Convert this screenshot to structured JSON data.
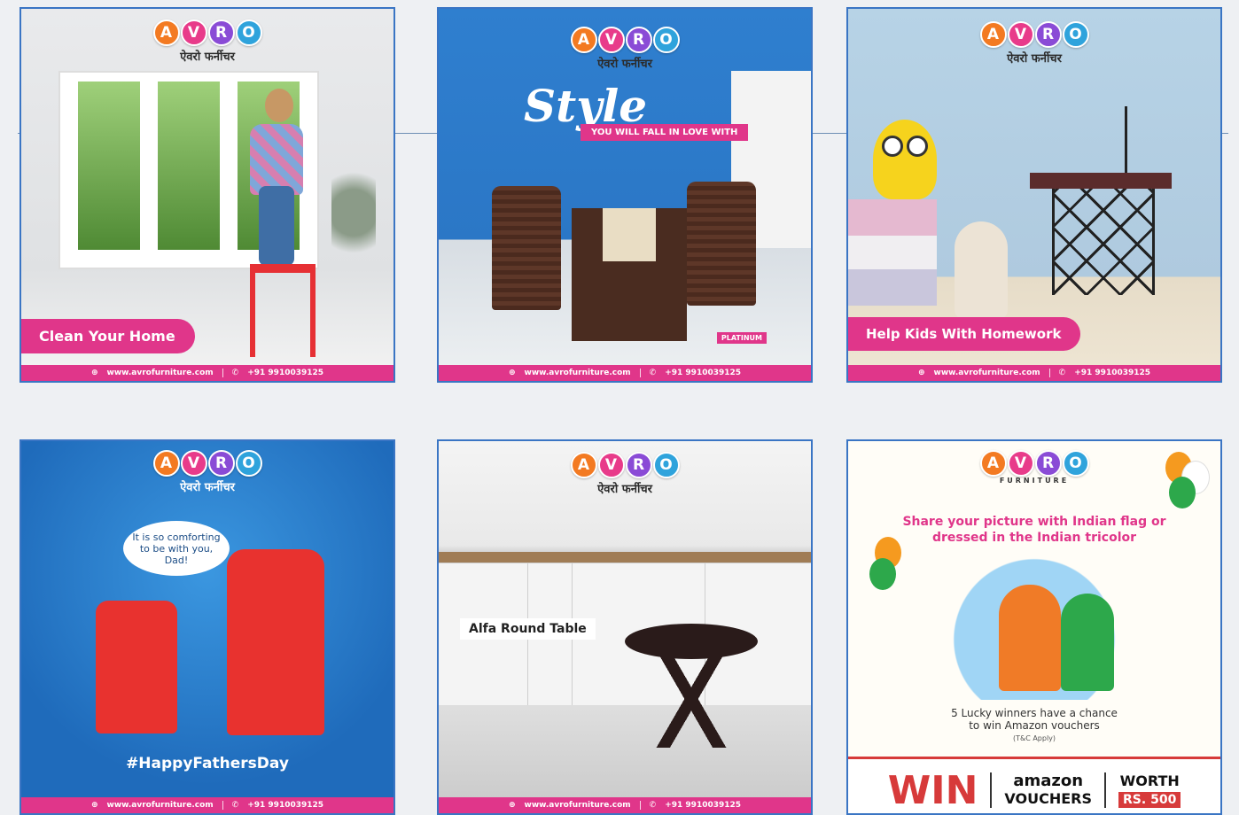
{
  "brand": {
    "letters": [
      "A",
      "V",
      "R",
      "O"
    ],
    "subtitle": "ऐवरो फर्नीचर",
    "subtitle_alt": "FURNITURE"
  },
  "footer": {
    "website": "www.avrofurniture.com",
    "phone": "+91 9910039125"
  },
  "tiles": [
    {
      "label": "Clean Your Home"
    },
    {
      "headline": "Style",
      "tagline": "YOU WILL FALL IN LOVE WITH",
      "badge": "PLATINUM"
    },
    {
      "label": "Help Kids With Homework"
    },
    {
      "bubble": "It is so comforting to be with you, Dad!",
      "hashtag": "#HappyFathersDay"
    },
    {
      "label": "Alfa Round Table"
    },
    {
      "share": "Share your picture with Indian flag or dressed in the Indian tricolor",
      "lucky": "5 Lucky winners have a chance to win Amazon vouchers",
      "tnc": "(T&C Apply)",
      "win": "WIN",
      "amazon": "amazon",
      "vouchers": "VOUCHERS",
      "worth": "WORTH",
      "amount": "RS. 500"
    }
  ],
  "colors": {
    "brand_pink": "#e0368a",
    "tile_border": "#3a75c4",
    "win_red": "#d73a3a"
  }
}
